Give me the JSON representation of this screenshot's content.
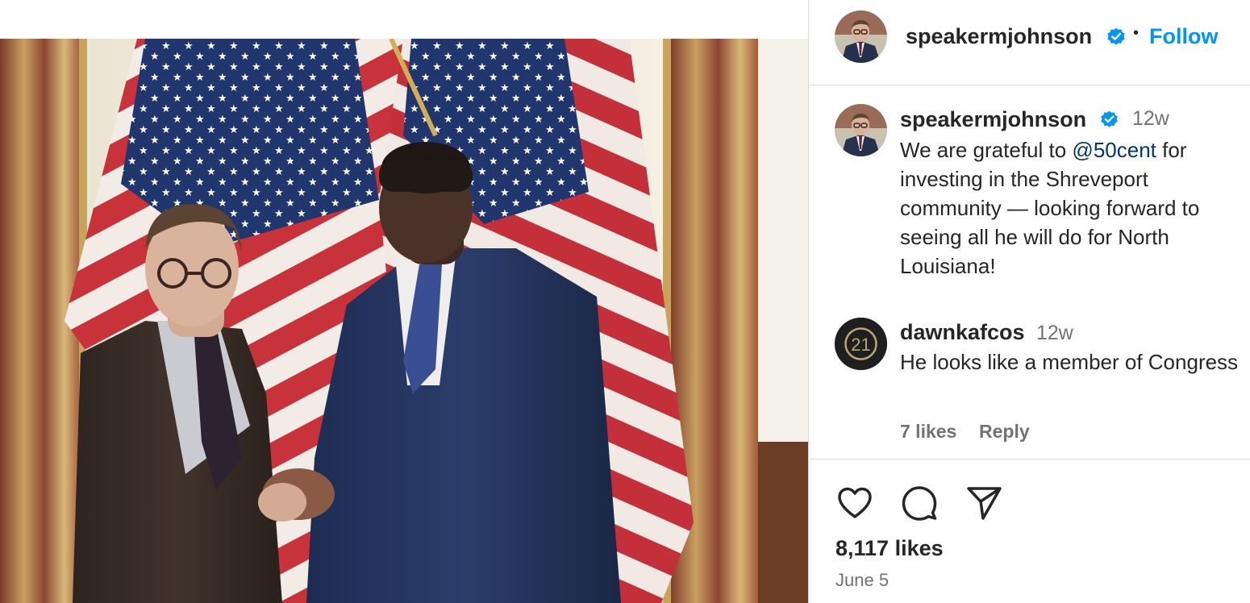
{
  "post": {
    "author": "speakermjohnson",
    "follow_label": "Follow",
    "separator": "•",
    "verified_icon": "verified-badge-icon",
    "caption": {
      "author": "speakermjohnson",
      "time": "12w",
      "text_before": "We are grateful to ",
      "mention": "@50cent",
      "text_after": " for investing in the Shreveport community — looking forward to seeing all he will do for North Louisiana!"
    },
    "comments": [
      {
        "author": "dawnkafcos",
        "avatar_text": "21",
        "time": "12w",
        "text": "He looks like a member of Congress",
        "likes": "7 likes",
        "reply_label": "Reply"
      }
    ],
    "actions": {
      "like_icon": "heart-icon",
      "comment_icon": "comment-bubble-icon",
      "share_icon": "paper-plane-icon"
    },
    "like_count": "8,117 likes",
    "date": "June 5"
  },
  "colors": {
    "follow": "#0095f6",
    "verified": "#0095f6",
    "mention": "#00376b",
    "secondary_text": "#737373",
    "divider": "#dbdbdb"
  }
}
